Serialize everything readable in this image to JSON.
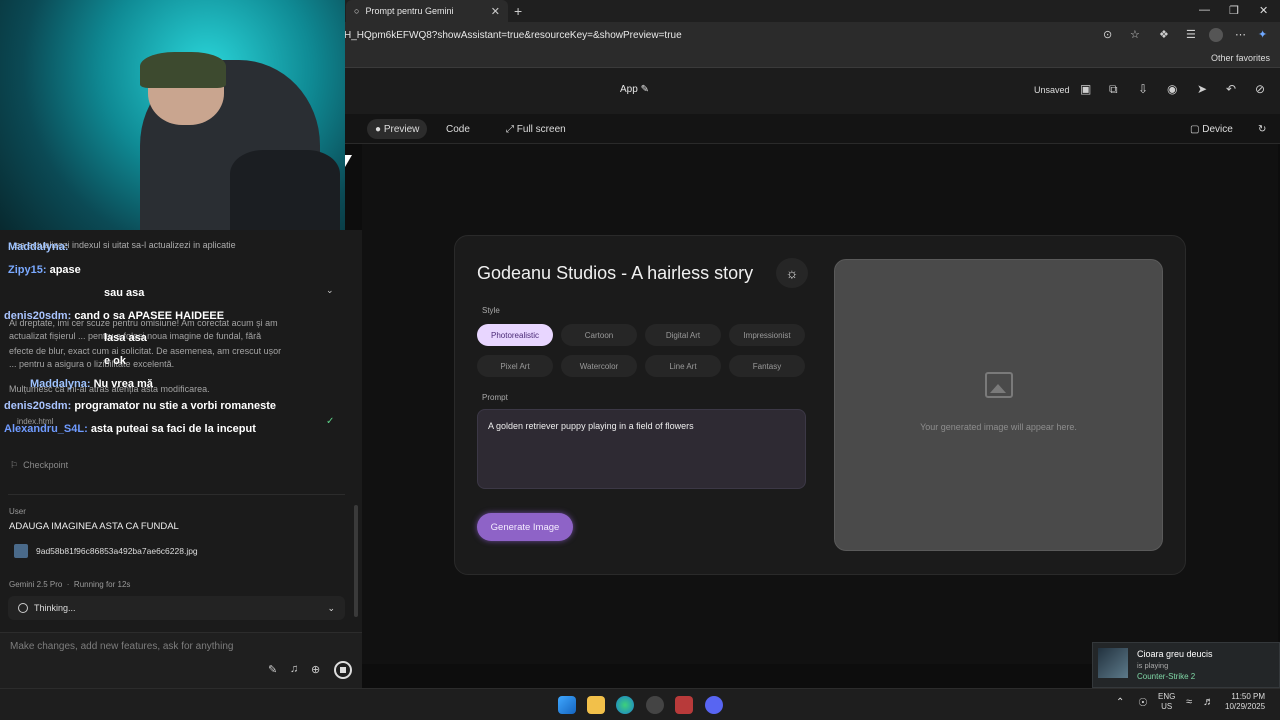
{
  "browser": {
    "tab_title": "Prompt pentru Gemini",
    "url": "H_HQpm6kEFWQ8?showAssistant=true&resourceKey=&showPreview=true",
    "other_favorites": "Other favorites"
  },
  "app_header": {
    "title": "App",
    "status": "Unsaved"
  },
  "toolbar": {
    "preview": "Preview",
    "code": "Code",
    "fullscreen": "Full screen",
    "device": "Device"
  },
  "preview_app": {
    "title": "Godeanu Studios - A hairless story",
    "style_label": "Style",
    "styles": [
      "Photorealistic",
      "Cartoon",
      "Digital Art",
      "Impressionist",
      "Pixel Art",
      "Watercolor",
      "Line Art",
      "Fantasy"
    ],
    "selected_style": "Photorealistic",
    "prompt_label": "Prompt",
    "prompt_value": "A golden retriever puppy playing in a field of flowers",
    "generate_button": "Generate Image",
    "placeholder_text": "Your generated image will appear here."
  },
  "chat_overlay": [
    {
      "user": "Maddalyna:",
      "message": ""
    },
    {
      "user": "Zipy15:",
      "message": "apase"
    },
    {
      "user": "",
      "message": "sau asa"
    },
    {
      "user": "denis20sdm:",
      "message": "cand o sa APASEE HAIDEEE"
    },
    {
      "user": "",
      "message": "lasa asa"
    },
    {
      "user": "",
      "message": "e ok"
    },
    {
      "user": "Maddalyna:",
      "message": "Nu vrea mă"
    },
    {
      "user": "denis20sdm:",
      "message": "programator nu stie a vorbi romaneste"
    },
    {
      "user": "Alexandru_S4L:",
      "message": "asta puteai sa faci de la inceput"
    }
  ],
  "assistant_panel": {
    "faded_lines": [
      "...sa actualizezi indexul si uitat sa-l actualizezi in aplicatie",
      "Ai dreptate, imi cer scuze pentru omisiune! Am corectat acum și am",
      "actualizat fișierul ... pentru a folosi noua imagine de fundal, fără",
      "efecte de blur, exact cum ai solicitat. De asemenea, am crescut ușor",
      "... pentru a asigura o lizibilitate excelentă.",
      "Mulțumesc că mi-ai atras atenția asta modificarea."
    ],
    "file_name": "index.html",
    "checkpoint": "Checkpoint",
    "user_label": "User",
    "user_message": "ADAUGA IMAGINEA ASTA CA FUNDAL",
    "attachment": "9ad58b81f96c86853a492ba7ae6c6228.jpg",
    "model": "Gemini 2.5 Pro",
    "running": "Running for 12s",
    "thinking": "Thinking...",
    "input_placeholder": "Make changes, add new features, ask for anything"
  },
  "notification": {
    "name": "Cioara greu deucis",
    "status": "is playing",
    "game": "Counter-Strike 2"
  },
  "taskbar": {
    "lang": "ENG",
    "region": "US",
    "time": "11:50 PM",
    "date": "10/29/2025"
  }
}
